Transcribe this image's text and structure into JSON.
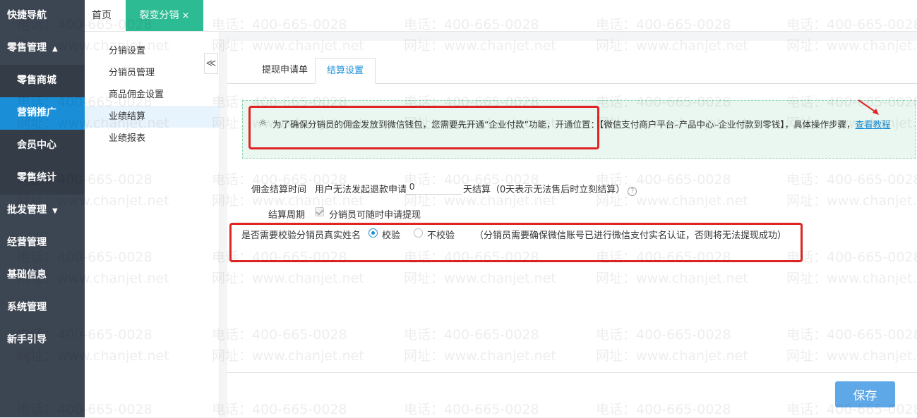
{
  "sidebar": {
    "items": [
      {
        "label": "快捷导航"
      },
      {
        "label": "零售管理",
        "caret": "▲"
      },
      {
        "label": "零售商城"
      },
      {
        "label": "营销推广"
      },
      {
        "label": "会员中心"
      },
      {
        "label": "零售统计"
      },
      {
        "label": "批发管理",
        "caret": "▼"
      },
      {
        "label": "经营管理"
      },
      {
        "label": "基础信息"
      },
      {
        "label": "系统管理"
      },
      {
        "label": "新手引导"
      }
    ]
  },
  "topbar": {
    "home": "首页",
    "active_tab": "裂变分销",
    "close": "×"
  },
  "submenu": {
    "items": [
      {
        "label": "分销设置"
      },
      {
        "label": "分销员管理"
      },
      {
        "label": "商品佣金设置"
      },
      {
        "label": "业绩结算"
      },
      {
        "label": "业绩报表"
      }
    ],
    "collapse": "≪"
  },
  "main": {
    "tabs": [
      {
        "label": "提现申请单"
      },
      {
        "label": "结算设置"
      }
    ],
    "notice": {
      "icon": "☼",
      "text": "为了确保分销员的佣金发放到微信钱包，您需要先开通“企业付款”功能，开通位置：【微信支付商户平台–产品中心–企业付款到零钱】，具体操作步骤，",
      "link": "查看教程"
    },
    "settlement_time": {
      "label": "佣金结算时间",
      "prefix": "用户无法发起退款申请",
      "days": "0",
      "suffix": "天结算（0天表示无法售后时立刻结算）",
      "help": "?"
    },
    "settlement_cycle": {
      "label": "结算周期",
      "checkbox_label": "分销员可随时申请提现",
      "checked": true
    },
    "real_name": {
      "label": "是否需要校验分销员真实姓名",
      "option_verify": "校验",
      "option_no_verify": "不校验",
      "hint": "（分销员需要确保微信账号已进行微信支付实名认证，否则将无法提现成功）"
    },
    "save": "保存"
  },
  "watermark": {
    "phone": "电话：400-665-0028",
    "site": "网址：www.chanjet.net"
  },
  "colors": {
    "sidebar_bg": "#3c4552",
    "sidebar_active": "#1a8fd8",
    "tab_active": "#2dbb94",
    "annotation_red": "#e02424",
    "save_button": "#5fa8e8"
  }
}
